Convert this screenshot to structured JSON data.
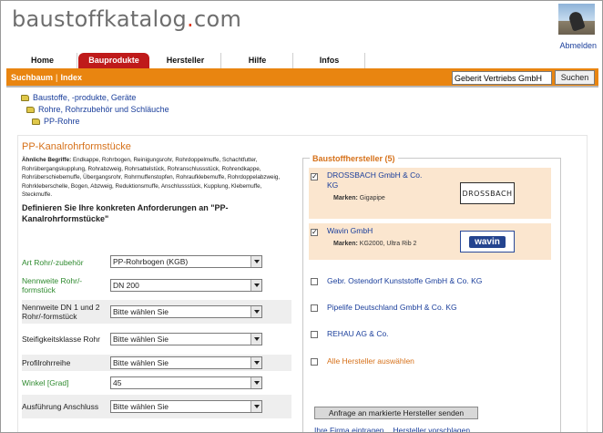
{
  "header": {
    "logo_main": "baustoffkatalog",
    "logo_dot": ".",
    "logo_tld": "com",
    "logout": "Abmelden"
  },
  "tabs": [
    {
      "label": "Home",
      "active": false
    },
    {
      "label": "Bauprodukte",
      "active": true
    },
    {
      "label": "Hersteller",
      "active": false
    },
    {
      "label": "Hilfe",
      "active": false
    },
    {
      "label": "Infos",
      "active": false
    }
  ],
  "toolbar": {
    "suchbaum": "Suchbaum",
    "separator": "|",
    "index": "Index",
    "search_value": "Geberit Vertriebs GmbH",
    "search_button": "Suchen"
  },
  "breadcrumb": [
    "Baustoffe, -produkte, Geräte",
    "Rohre, Rohrzubehör und Schläuche",
    "PP-Rohre"
  ],
  "product": {
    "title": "PP-Kanalrohrformstücke",
    "similar_label": "Ähnliche Begriffe:",
    "similar_terms": "Endkappe, Rohrbogen, Reinigungsrohr, Rohrdoppelmuffe, Schachtfutter, Rohrübergangskupplung, Rohrabzweig, Rohrsattelstück, Rohranschlussstück, Rohrendkappe, Rohrüberschiebemuffe, Übergangsrohr, Rohrmuffenstopfen, Rohraufklebemuffe, Rohrdoppelabzweig, Rohrkleberschelle, Bogen, Abzweig, Reduktionsmuffe, Anschlussstück, Kupplung, Klebemuffe, Steckmuffe.",
    "prompt": "Definieren Sie Ihre konkreten Anforderungen an \"PP-Kanalrohrformstücke\""
  },
  "filters": [
    {
      "label": "Art Rohr/-zubehör",
      "value": "PP-Rohrbogen (KGB)",
      "green": true
    },
    {
      "label": "Nennweite Rohr/-formstück",
      "value": "DN 200",
      "green": true
    },
    {
      "label": "Nennweite DN 1 und 2 Rohr/-formstück",
      "value": "Bitte wählen Sie",
      "green": false
    },
    {
      "label": "Steifigkeitsklasse Rohr",
      "value": "Bitte wählen Sie",
      "green": false
    },
    {
      "label": "Profilrohrreihe",
      "value": "Bitte wählen Sie",
      "green": false
    },
    {
      "label": "Winkel [Grad]",
      "value": "45",
      "green": true
    },
    {
      "label": "Ausführung Anschluss",
      "value": "Bitte wählen Sie",
      "green": false
    }
  ],
  "manufacturers": {
    "title": "Baustoffhersteller (5)",
    "brands_label": "Marken:",
    "items": [
      {
        "name": "DROSSBACH GmbH & Co. KG",
        "brands": "Gigapipe",
        "checked": true,
        "logo": "DROSSBACH",
        "logo_icon": "drossbach-logo"
      },
      {
        "name": "Wavin GmbH",
        "brands": "KG2000, Ultra Rib 2",
        "checked": true,
        "logo": "wavin",
        "logo_icon": "wavin-logo"
      },
      {
        "name": "Gebr. Ostendorf Kunststoffe GmbH & Co. KG",
        "checked": false
      },
      {
        "name": "Pipelife Deutschland GmbH & Co. KG",
        "checked": false
      },
      {
        "name": "REHAU AG & Co.",
        "checked": false
      }
    ],
    "select_all": "Alle Hersteller auswählen",
    "request_button": "Anfrage an markierte Hersteller senden",
    "link_register": "Ihre Firma eintragen",
    "link_suggest": "Hersteller vorschlagen"
  },
  "colors": {
    "accent_orange": "#e98510",
    "tab_active": "#bf1a1a",
    "title_orange": "#d6711a",
    "link_blue": "#1a3e9b",
    "label_green": "#2e8a2e"
  }
}
